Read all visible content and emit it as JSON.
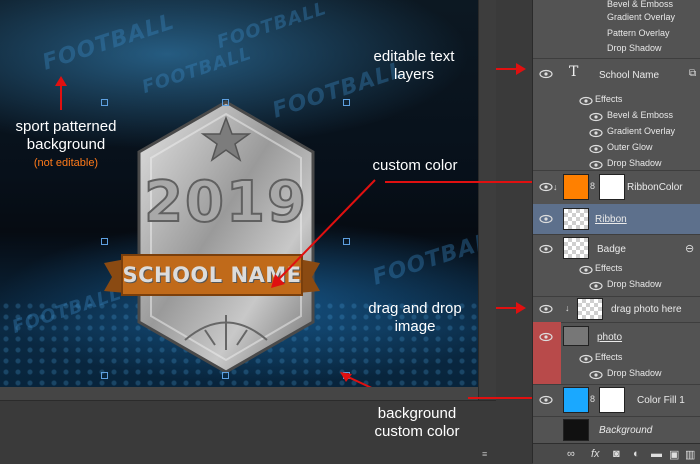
{
  "canvas": {
    "watermark_text": "FOOTBALL",
    "year": "2019",
    "ribbon_text": "SCHOOL NAME",
    "labels": {
      "sport_background": "sport patterned background",
      "not_editable": "(not editable)",
      "editable_text": "editable text layers",
      "custom_color": "custom color",
      "drag_drop": "drag and drop image",
      "background_color": "background custom color"
    }
  },
  "layers": {
    "top_effects": [
      "Bevel & Emboss",
      "Gradient Overlay",
      "Pattern Overlay",
      "Drop Shadow"
    ],
    "school_name": {
      "name": "School Name",
      "type_icon": "T",
      "effects_label": "Effects",
      "effects": [
        "Bevel & Emboss",
        "Gradient Overlay",
        "Outer Glow",
        "Drop Shadow"
      ]
    },
    "ribbon_color": {
      "name": "RibbonColor",
      "swatch": "#ff8000"
    },
    "ribbon": {
      "name": "Ribbon"
    },
    "badge": {
      "name": "Badge",
      "effects_label": "Effects",
      "effects": [
        "Drop Shadow"
      ]
    },
    "drag_photo": {
      "name": "drag photo here"
    },
    "photo": {
      "name": "photo",
      "effects_label": "Effects",
      "effects": [
        "Drop Shadow"
      ]
    },
    "color_fill": {
      "name": "Color Fill 1",
      "swatch": "#1aa8ff"
    },
    "background": {
      "name": "Background"
    }
  },
  "colors": {
    "accent_red": "#e01010",
    "ribbon_orange": "#c06a1a",
    "selected_row": "#5d708c",
    "photo_eye_bg": "#b84a4a"
  },
  "icons": [
    "eye-icon",
    "type-layer-icon",
    "link-icon",
    "fx-icon",
    "mask-icon",
    "adjustment-icon",
    "folder-icon",
    "new-layer-icon",
    "trash-icon"
  ]
}
